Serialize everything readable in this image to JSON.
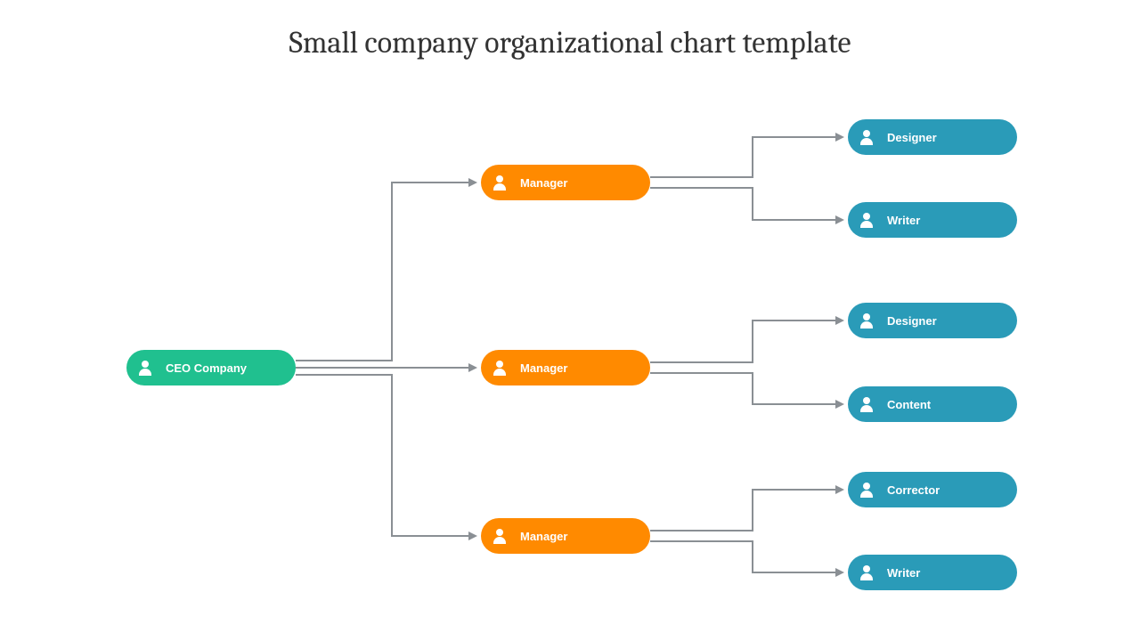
{
  "title": "Small company organizational chart template",
  "ceo": {
    "label": "CEO Company"
  },
  "managers": [
    {
      "label": "Manager"
    },
    {
      "label": "Manager"
    },
    {
      "label": "Manager"
    }
  ],
  "roles": [
    [
      {
        "label": "Designer"
      },
      {
        "label": "Writer"
      }
    ],
    [
      {
        "label": "Designer"
      },
      {
        "label": "Content"
      }
    ],
    [
      {
        "label": "Corrector"
      },
      {
        "label": "Writer"
      }
    ]
  ],
  "colors": {
    "ceo": "#20c08f",
    "manager": "#ff8a00",
    "role": "#2a9bb8",
    "connector": "#8a8f94"
  }
}
